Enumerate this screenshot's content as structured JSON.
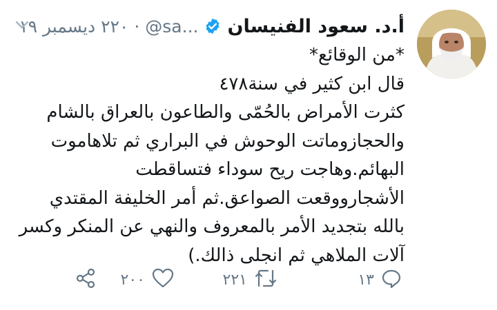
{
  "author": {
    "display_name": "أ.د. سعود الفنيسان",
    "handle": "@sa...",
    "date": "٢٢٠ ديسمبر ١٩",
    "verified": true,
    "avatar_icon": "profile-photo"
  },
  "tweet": {
    "lines": [
      "*من الوقائع*",
      "قال ابن كثير في سنة٤٧٨",
      "كثرت الأمراض بالحُمّى والطاعون بالعراق بالشام",
      "والحجازوماتت الوحوش في البراري ثم تلاهاموت",
      "البهائم.وهاجت ريح سوداء فتساقطت",
      "الأشجاروو‌قعت الصواعق.ثم أمر الخليفة المقتدي",
      "بالله بتجديد الأمر بالمعروف والنهي عن المنكر وكسر",
      "آلات الملاهي ثم انجلى ذالك.)"
    ]
  },
  "actions": {
    "reply": {
      "icon": "reply-icon",
      "count": "١٣"
    },
    "retweet": {
      "icon": "retweet-icon",
      "count": "٢٢١"
    },
    "like": {
      "icon": "heart-icon",
      "count": "٢٠٠"
    },
    "share": {
      "icon": "share-icon"
    }
  },
  "colors": {
    "text": "#14171a",
    "secondary": "#657786",
    "verified": "#1da1f2"
  }
}
